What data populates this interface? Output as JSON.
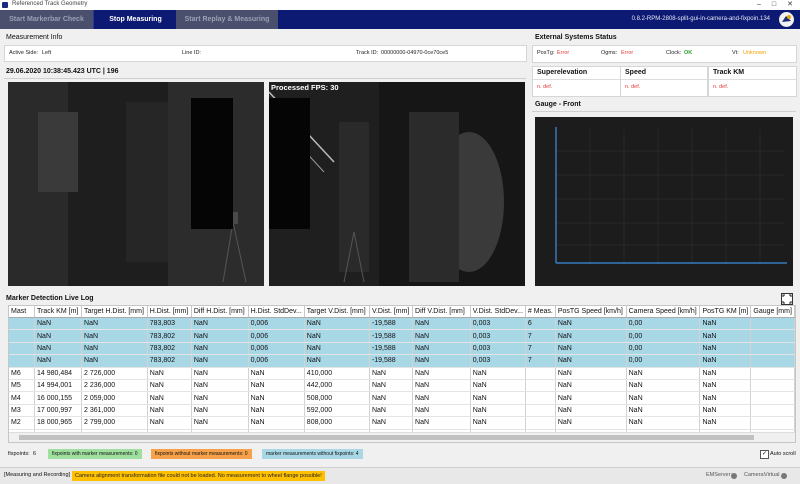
{
  "window": {
    "title": "Referenced Track Geometry"
  },
  "toolbar": {
    "start_marker_check": "Start Markerbar Check",
    "stop_measuring": "Stop Measuring",
    "start_replay": "Start Replay & Measuring",
    "version": "0.8.2-RPM-2808-split-gui-in-camera-and-fixpoin.134"
  },
  "measurement_info": {
    "title": "Measurement Info",
    "active_side_label": "Active Side:",
    "active_side_value": "Left",
    "line_id_label": "Line ID:",
    "line_id_value": "",
    "track_id_label": "Track ID:",
    "track_id_value": "00000000-04970-0ce70ce5"
  },
  "timestamp": "29.06.2020 10:38:45.423 UTC | 196",
  "video": {
    "fps_label": "Processed FPS: 30"
  },
  "external": {
    "title": "External Systems Status",
    "postg_label": "PosTg:",
    "postg_value": "Error",
    "ogms_label": "Ogms:",
    "ogms_value": "Error",
    "clock_label": "Clock:",
    "clock_value": "OK",
    "vt_label": "Vt:",
    "vt_value": "Unknown",
    "colors": {
      "error": "#e53935",
      "ok": "#2e9e2e",
      "unknown": "#f0a000"
    }
  },
  "metrics": {
    "superelevation_label": "Superelevation",
    "superelevation_value": "n. def.",
    "speed_label": "Speed",
    "speed_value": "n. def.",
    "track_km_label": "Track KM",
    "track_km_value": "n. def."
  },
  "gauge": {
    "title": "Gauge - Front"
  },
  "log": {
    "title": "Marker Detection Live Log",
    "columns": [
      "Mast",
      "Track KM [m]",
      "Target H.Dist. [mm]",
      "H.Dist. [mm]",
      "Diff H.Dist. [mm]",
      "H.Dist. StdDev...",
      "Target V.Dist. [mm]",
      "V.Dist. [mm]",
      "Diff V.Dist. [mm]",
      "V.Dist. StdDev...",
      "# Meas.",
      "PosTG Speed [km/h]",
      "Camera Speed [km/h]",
      "PosTG KM [m]",
      "Gauge [mm]"
    ],
    "rows": [
      {
        "hl": true,
        "cells": [
          "",
          "NaN",
          "NaN",
          "783,803",
          "NaN",
          "0,006",
          "NaN",
          "-19,588",
          "NaN",
          "0,003",
          "6",
          "NaN",
          "0,00",
          "NaN",
          ""
        ]
      },
      {
        "hl": true,
        "cells": [
          "",
          "NaN",
          "NaN",
          "783,802",
          "NaN",
          "0,006",
          "NaN",
          "-19,588",
          "NaN",
          "0,003",
          "7",
          "NaN",
          "0,00",
          "NaN",
          ""
        ]
      },
      {
        "hl": true,
        "cells": [
          "",
          "NaN",
          "NaN",
          "783,802",
          "NaN",
          "0,006",
          "NaN",
          "-19,588",
          "NaN",
          "0,003",
          "7",
          "NaN",
          "0,00",
          "NaN",
          ""
        ]
      },
      {
        "hl": true,
        "cells": [
          "",
          "NaN",
          "NaN",
          "783,802",
          "NaN",
          "0,006",
          "NaN",
          "-19,588",
          "NaN",
          "0,003",
          "7",
          "NaN",
          "0,00",
          "NaN",
          ""
        ]
      },
      {
        "hl": false,
        "cells": [
          "M6",
          "14 980,484",
          "2 726,000",
          "NaN",
          "NaN",
          "NaN",
          "410,000",
          "NaN",
          "NaN",
          "NaN",
          "",
          "NaN",
          "NaN",
          "NaN",
          ""
        ]
      },
      {
        "hl": false,
        "cells": [
          "M5",
          "14 994,001",
          "2 236,000",
          "NaN",
          "NaN",
          "NaN",
          "442,000",
          "NaN",
          "NaN",
          "NaN",
          "",
          "NaN",
          "NaN",
          "NaN",
          ""
        ]
      },
      {
        "hl": false,
        "cells": [
          "M4",
          "16 000,155",
          "2 059,000",
          "NaN",
          "NaN",
          "NaN",
          "508,000",
          "NaN",
          "NaN",
          "NaN",
          "",
          "NaN",
          "NaN",
          "NaN",
          ""
        ]
      },
      {
        "hl": false,
        "cells": [
          "M3",
          "17 000,997",
          "2 361,000",
          "NaN",
          "NaN",
          "NaN",
          "592,000",
          "NaN",
          "NaN",
          "NaN",
          "",
          "NaN",
          "NaN",
          "NaN",
          ""
        ]
      },
      {
        "hl": false,
        "cells": [
          "M2",
          "18 000,965",
          "2 799,000",
          "NaN",
          "NaN",
          "NaN",
          "808,000",
          "NaN",
          "NaN",
          "NaN",
          "",
          "NaN",
          "NaN",
          "NaN",
          ""
        ]
      },
      {
        "hl": false,
        "cells": [
          "M1",
          "19 000,110",
          "2 292,000",
          "NaN",
          "NaN",
          "NaN",
          "633,000",
          "NaN",
          "NaN",
          "NaN",
          "",
          "NaN",
          "NaN",
          "NaN",
          ""
        ]
      }
    ]
  },
  "legend": {
    "fixpoints_label": "fixpoints:",
    "fixpoints_value": "6",
    "with_marker": "fixpoints with marker measurements:  0",
    "without_marker": "fixpoints without marker measurements:  0",
    "without_fixpoints": "marker measurements without fixpoints:  4",
    "autoscroll": "Auto scroll"
  },
  "status": {
    "mode": "[Measuring and Recording]",
    "warning": "Camera alignment transformation file could not be loaded. No measurement to wheel flange possible!",
    "emserver_label": "EMServer:",
    "camera_label": "Camera:",
    "camera_value": "Virtual"
  }
}
